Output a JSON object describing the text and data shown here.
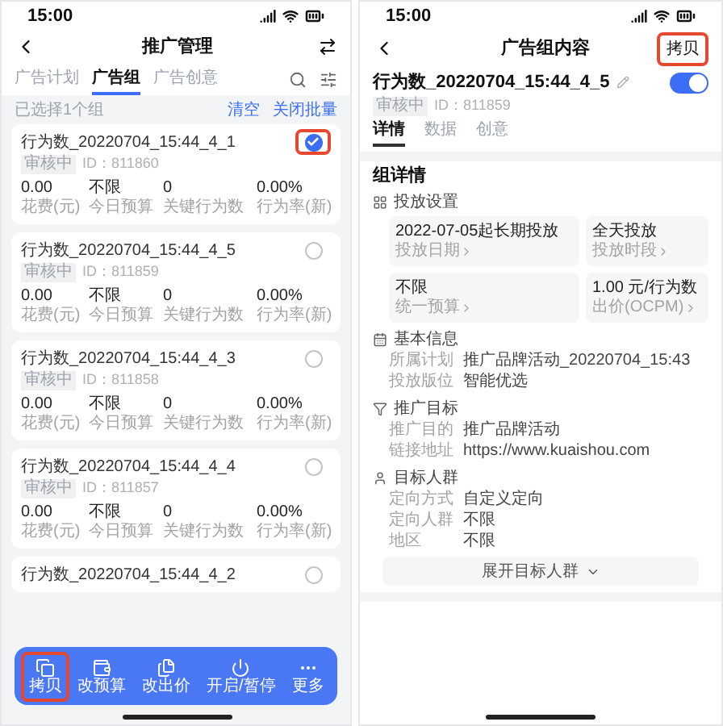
{
  "left_screen": {
    "status_bar": {
      "time": "15:00"
    },
    "nav": {
      "title": "推广管理"
    },
    "tabs": [
      {
        "label": "广告计划",
        "selected": false
      },
      {
        "label": "广告组",
        "selected": true
      },
      {
        "label": "广告创意",
        "selected": false
      }
    ],
    "selection": {
      "text": "已选择1个组",
      "actions": [
        "清空",
        "关闭批量"
      ]
    },
    "cards": [
      {
        "title": "行为数_20220704_15:44_4_1",
        "status": "审核中",
        "id": "ID：811860",
        "selected": true,
        "highlighted": true,
        "metrics": [
          {
            "value": "0.00",
            "label": "花费(元)"
          },
          {
            "value": "不限",
            "label": "今日预算"
          },
          {
            "value": "0",
            "label": "关键行为数"
          },
          {
            "value": "0.00%",
            "label": "行为率(新)"
          }
        ]
      },
      {
        "title": "行为数_20220704_15:44_4_5",
        "status": "审核中",
        "id": "ID：811859",
        "selected": false,
        "highlighted": false,
        "metrics": [
          {
            "value": "0.00",
            "label": "花费(元)"
          },
          {
            "value": "不限",
            "label": "今日预算"
          },
          {
            "value": "0",
            "label": "关键行为数"
          },
          {
            "value": "0.00%",
            "label": "行为率(新)"
          }
        ]
      },
      {
        "title": "行为数_20220704_15:44_4_3",
        "status": "审核中",
        "id": "ID：811858",
        "selected": false,
        "highlighted": false,
        "metrics": [
          {
            "value": "0.00",
            "label": "花费(元)"
          },
          {
            "value": "不限",
            "label": "今日预算"
          },
          {
            "value": "0",
            "label": "关键行为数"
          },
          {
            "value": "0.00%",
            "label": "行为率(新)"
          }
        ]
      },
      {
        "title": "行为数_20220704_15:44_4_4",
        "status": "审核中",
        "id": "ID：811857",
        "selected": false,
        "highlighted": false,
        "metrics": [
          {
            "value": "0.00",
            "label": "花费(元)"
          },
          {
            "value": "不限",
            "label": "今日预算"
          },
          {
            "value": "0",
            "label": "关键行为数"
          },
          {
            "value": "0.00%",
            "label": "行为率(新)"
          }
        ]
      }
    ],
    "last_card": {
      "title": "行为数_20220704_15:44_4_2",
      "selected": false
    },
    "toolbar": [
      {
        "kind": "copy",
        "label": "拷贝",
        "highlighted": true
      },
      {
        "kind": "budget",
        "label": "改预算",
        "highlighted": false
      },
      {
        "kind": "bid",
        "label": "改出价",
        "highlighted": false
      },
      {
        "kind": "power",
        "label": "开启/暂停",
        "highlighted": false
      },
      {
        "kind": "more",
        "label": "更多",
        "highlighted": false
      }
    ]
  },
  "right_screen": {
    "status_bar": {
      "time": "15:00"
    },
    "nav": {
      "title": "广告组内容",
      "action": {
        "label": "拷贝",
        "highlighted": true
      }
    },
    "group": {
      "title": "行为数_20220704_15:44_4_5",
      "status": "审核中",
      "id": "ID：811859",
      "on": true
    },
    "tabs": [
      {
        "label": "详情",
        "selected": true
      },
      {
        "label": "数据",
        "selected": false
      },
      {
        "label": "创意",
        "selected": false
      }
    ],
    "section_title": "组详情",
    "sections": [
      {
        "kind": "settings",
        "title": "投放设置",
        "tiles": [
          {
            "value": "2022-07-05起长期投放",
            "label": "投放日期"
          },
          {
            "value": "全天投放",
            "label": "投放时段"
          },
          {
            "value": "不限",
            "label": "统一预算"
          },
          {
            "value": "1.00 元/行为数",
            "label": "出价(OCPM)"
          }
        ]
      },
      {
        "kind": "info",
        "title": "基本信息",
        "rows": [
          {
            "label": "所属计划",
            "value": "推广品牌活动_20220704_15:43"
          },
          {
            "label": "投放版位",
            "value": "智能优选"
          }
        ]
      },
      {
        "kind": "target",
        "title": "推广目标",
        "rows": [
          {
            "label": "推广目的",
            "value": "推广品牌活动"
          },
          {
            "label": "链接地址",
            "value": "https://www.kuaishou.com"
          }
        ]
      },
      {
        "kind": "audience",
        "title": "目标人群",
        "rows": [
          {
            "label": "定向方式",
            "value": "自定义定向"
          },
          {
            "label": "定向人群",
            "value": "不限"
          },
          {
            "label": "地区",
            "value": "不限"
          }
        ]
      }
    ],
    "expand_button": "展开目标人群"
  }
}
